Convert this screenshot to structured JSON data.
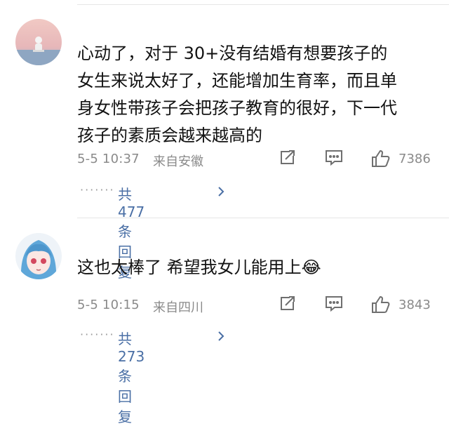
{
  "comments": [
    {
      "text": "心动了，对于 30+没有结婚有想要孩子的\n女生来说太好了，还能增加生育率，而且单\n身女性带孩子会把孩子教育的很好，下一代\n孩子的素质会越来越高的",
      "time": "5-5 10:37",
      "location": "来自安徽",
      "likes": "7386",
      "replies_label": "共477条回复",
      "replies_dots": "·······",
      "avatar_icon": "astronaut-avatar"
    },
    {
      "text": "这也太棒了 希望我女儿能用上😂",
      "time": "5-5 10:15",
      "location": "来自四川",
      "likes": "3843",
      "replies_label": "共273条回复",
      "replies_dots": "·······",
      "avatar_icon": "anime-girl-avatar"
    }
  ],
  "icons": {
    "share": "share-icon",
    "comment": "comment-icon",
    "like": "thumbs-up-icon",
    "chevron": "chevron-right-icon"
  },
  "colors": {
    "text": "#121212",
    "meta": "#8a8a8a",
    "link": "#4a6fa5",
    "divider": "#e6e6e6"
  }
}
